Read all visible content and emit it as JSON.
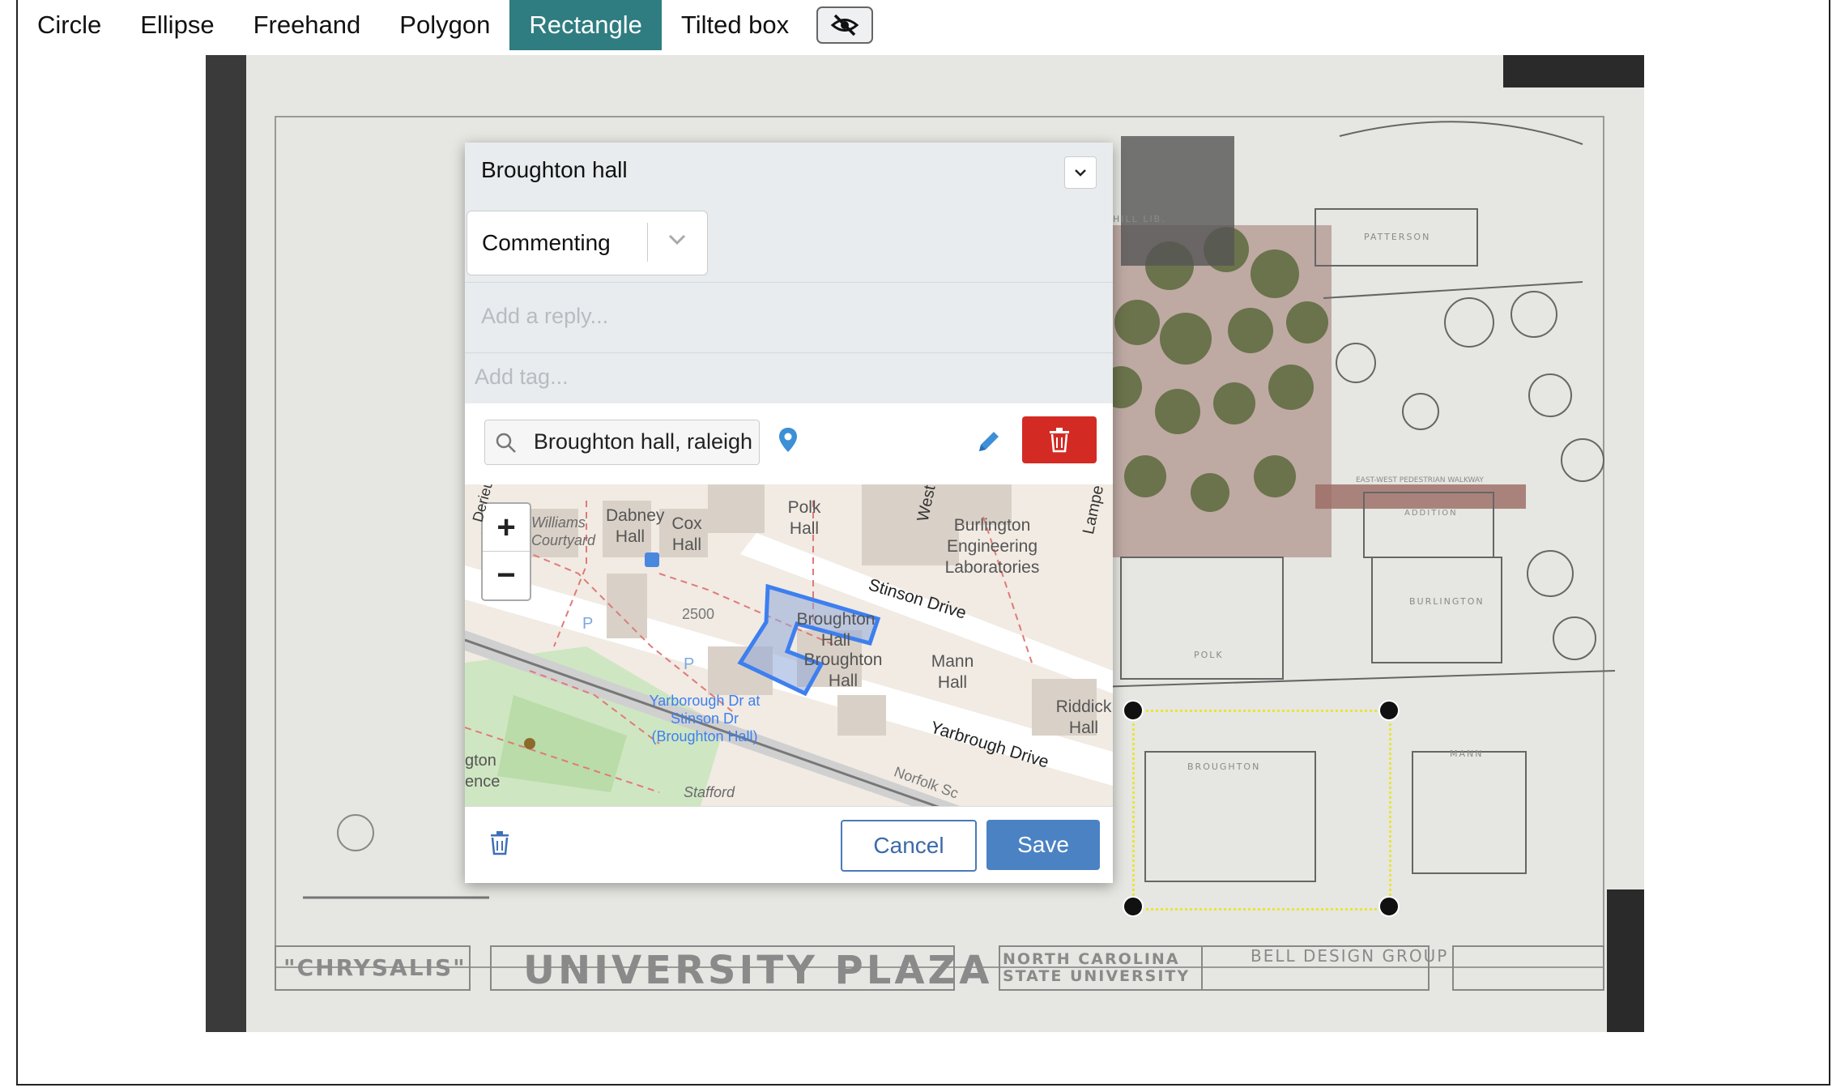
{
  "toolbar": {
    "tools": [
      "Circle",
      "Ellipse",
      "Freehand",
      "Polygon",
      "Rectangle",
      "Tilted box"
    ],
    "active_tool": "Rectangle",
    "visibility_icon": "eye-slash-icon"
  },
  "plan": {
    "title_left": "\"CHRYSALIS\"",
    "title_main": "UNIVERSITY PLAZA",
    "university": "NORTH CAROLINA STATE UNIVERSITY",
    "firm": "BELL DESIGN GROUP",
    "buildings": [
      "PATTERSON",
      "BURLINGTON",
      "POLK",
      "BROUGHTON",
      "MANN",
      "ADDITION",
      "HILL LIB."
    ],
    "walkways": [
      "EAST-WEST PEDESTRIAN WALKWAY"
    ]
  },
  "popup": {
    "title": "Broughton hall",
    "purpose": "Commenting",
    "reply_placeholder": "Add a reply...",
    "tag_placeholder": "Add tag...",
    "geo_search": "Broughton hall, raleigh",
    "cancel": "Cancel",
    "save": "Save"
  },
  "map": {
    "zoom_in": "+",
    "zoom_out": "−",
    "labels": {
      "dabney": "Dabney Hall",
      "cox": "Cox Hall",
      "polk": "Polk Hall",
      "west": "West",
      "burlington": "Burlington Engineering Laboratories",
      "lampe": "Lampe",
      "williams": "Williams Courtyard",
      "stinson": "Stinson Drive",
      "num2500": "2500",
      "broughton_sel": "Broughton Hall",
      "broughton": "Broughton Hall",
      "mann": "Mann Hall",
      "riddick": "Riddick Hall",
      "yarbrough_dr": "Yarbrough Drive",
      "stop": "Yarborough Dr at Stinson Dr (Broughton Hall)",
      "stafford": "Stafford",
      "norfolk": "Norfolk Sc",
      "derieu": "Derieu",
      "gton": "gton",
      "ence": "ence"
    }
  },
  "colors": {
    "active_tool": "#2f7d80",
    "delete_red": "#d42a24",
    "save_blue": "#4a82c4",
    "selection_yellow": "#e8e53a",
    "map_polygon": "#3d7ff0"
  }
}
